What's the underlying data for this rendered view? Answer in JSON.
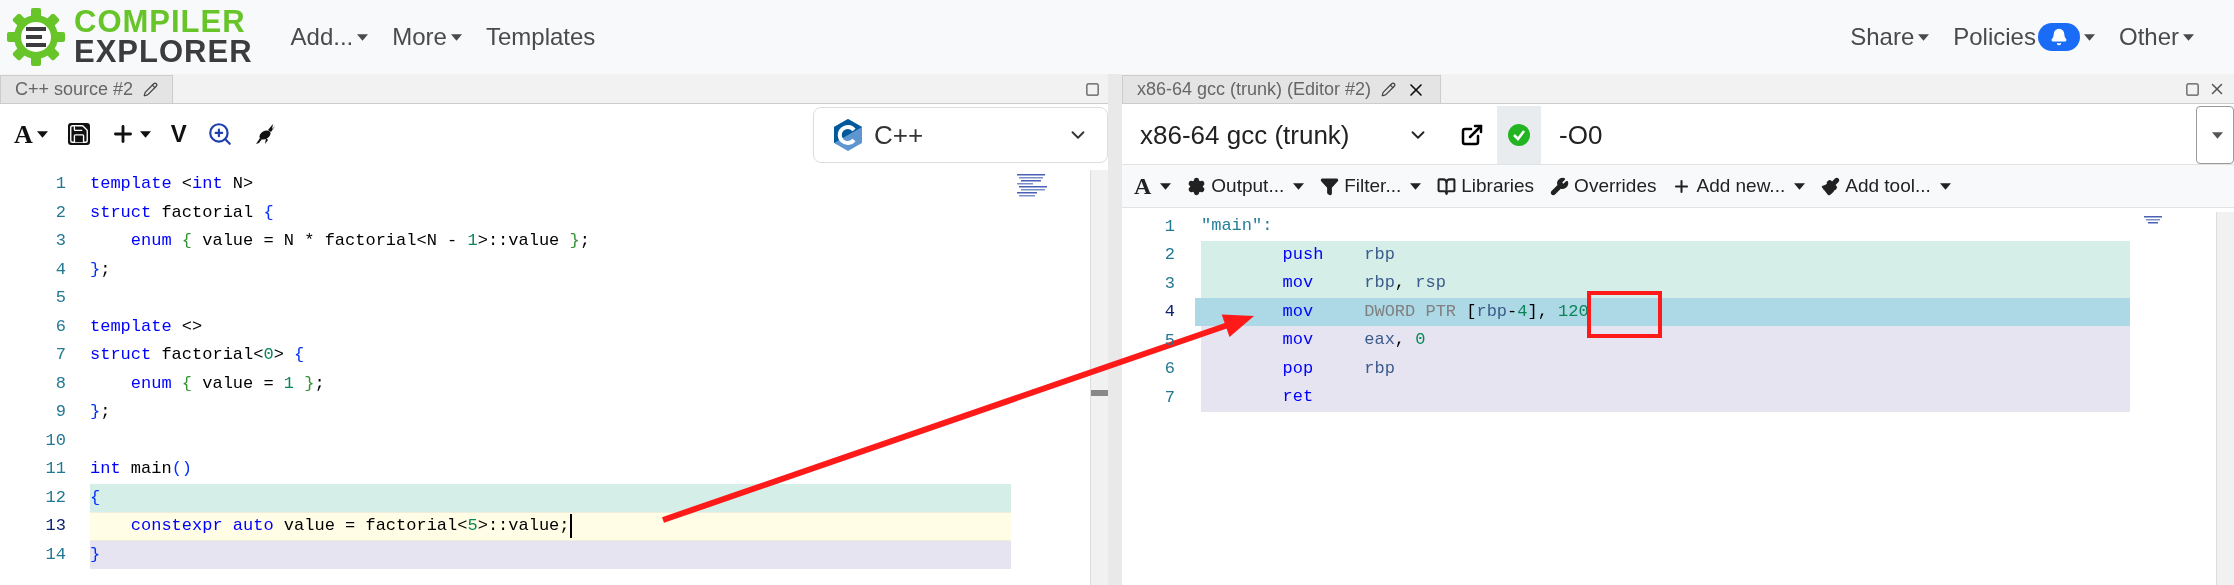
{
  "navbar": {
    "logo": {
      "line1": "COMPILER",
      "line2": "EXPLORER"
    },
    "menus": [
      {
        "label": "Add...",
        "dropdown": true
      },
      {
        "label": "More",
        "dropdown": true
      },
      {
        "label": "Templates",
        "dropdown": false
      }
    ],
    "right_menus": [
      {
        "label": "Share",
        "dropdown": true,
        "notification": false
      },
      {
        "label": "Policies",
        "dropdown": true,
        "notification": true
      },
      {
        "label": "Other",
        "dropdown": true,
        "notification": false
      }
    ]
  },
  "source_pane": {
    "tab": {
      "title": "C++ source #2"
    },
    "toolbar": [
      {
        "kind": "font",
        "label": "A",
        "dropdown": true
      },
      {
        "kind": "save",
        "dropdown": false
      },
      {
        "kind": "add",
        "dropdown": true
      },
      {
        "kind": "vim",
        "label": "V",
        "dropdown": false
      },
      {
        "kind": "insights",
        "dropdown": false
      },
      {
        "kind": "bench",
        "dropdown": false
      }
    ],
    "language": "C++",
    "lines": [
      {
        "number": "1",
        "current": false,
        "tokens": [
          {
            "text": "template",
            "kind": "keyword"
          },
          {
            "text": " <",
            "kind": "plain"
          },
          {
            "text": "int",
            "kind": "keyword"
          },
          {
            "text": " N>",
            "kind": "plain"
          }
        ]
      },
      {
        "number": "2",
        "current": false,
        "tokens": [
          {
            "text": "struct",
            "kind": "keyword"
          },
          {
            "text": " factorial ",
            "kind": "plain"
          },
          {
            "text": "{",
            "kind": "bracket_1"
          }
        ]
      },
      {
        "number": "3",
        "current": false,
        "tokens": [
          {
            "text": "    enum",
            "kind": "keyword"
          },
          {
            "text": " {",
            "kind": "bracket_2"
          },
          {
            "text": " value = N * factorial<N - ",
            "kind": "plain"
          },
          {
            "text": "1",
            "kind": "number"
          },
          {
            "text": ">::value ",
            "kind": "plain"
          },
          {
            "text": "}",
            "kind": "bracket_2"
          },
          {
            "text": ";",
            "kind": "plain"
          }
        ]
      },
      {
        "number": "4",
        "current": false,
        "tokens": [
          {
            "text": "}",
            "kind": "bracket_1"
          },
          {
            "text": ";",
            "kind": "plain"
          }
        ]
      },
      {
        "number": "5",
        "current": false
      },
      {
        "number": "6",
        "current": false,
        "tokens": [
          {
            "text": "template",
            "kind": "keyword"
          },
          {
            "text": " <>",
            "kind": "plain"
          }
        ]
      },
      {
        "number": "7",
        "current": false,
        "tokens": [
          {
            "text": "struct",
            "kind": "keyword"
          },
          {
            "text": " factorial<",
            "kind": "plain"
          },
          {
            "text": "0",
            "kind": "number"
          },
          {
            "text": "> ",
            "kind": "plain"
          },
          {
            "text": "{",
            "kind": "bracket_1"
          }
        ]
      },
      {
        "number": "8",
        "current": false,
        "tokens": [
          {
            "text": "    enum",
            "kind": "keyword"
          },
          {
            "text": " {",
            "kind": "bracket_2"
          },
          {
            "text": " value = ",
            "kind": "plain"
          },
          {
            "text": "1",
            "kind": "number"
          },
          {
            "text": " }",
            "kind": "bracket_2"
          },
          {
            "text": ";",
            "kind": "plain"
          }
        ]
      },
      {
        "number": "9",
        "current": false,
        "tokens": [
          {
            "text": "}",
            "kind": "bracket_1"
          },
          {
            "text": ";",
            "kind": "plain"
          }
        ]
      },
      {
        "number": "10",
        "current": false
      },
      {
        "number": "11",
        "current": false,
        "tokens": [
          {
            "text": "int",
            "kind": "keyword"
          },
          {
            "text": " main",
            "kind": "plain"
          },
          {
            "text": "()",
            "kind": "bracket_1"
          }
        ]
      },
      {
        "number": "12",
        "color": "#d5eee7",
        "current": false,
        "tokens": [
          {
            "text": "{",
            "kind": "bracket_1"
          }
        ]
      },
      {
        "number": "13",
        "current": true,
        "tokens": [
          {
            "text": "    constexpr",
            "kind": "keyword"
          },
          {
            "text": " auto",
            "kind": "keyword"
          },
          {
            "text": " value = factorial<",
            "kind": "plain"
          },
          {
            "text": "5",
            "kind": "number"
          },
          {
            "text": ">::value;",
            "kind": "plain"
          }
        ]
      },
      {
        "number": "14",
        "color": "#e6e4f0",
        "current": false,
        "tokens": [
          {
            "text": "}",
            "kind": "bracket_1"
          }
        ]
      }
    ]
  },
  "compiler_pane": {
    "tab": {
      "title": "x86-64 gcc (trunk) (Editor #2)"
    },
    "compiler": "x86-64 gcc (trunk)",
    "status_ok": true,
    "options": "-O0",
    "toolbar": [
      {
        "kind": "font",
        "label": "A",
        "dropdown": true
      },
      {
        "kind": "output",
        "label": "Output...",
        "dropdown": true
      },
      {
        "kind": "filter",
        "label": "Filter...",
        "dropdown": true
      },
      {
        "kind": "libraries",
        "label": "Libraries",
        "dropdown": false
      },
      {
        "kind": "overrides",
        "label": "Overrides",
        "dropdown": false
      },
      {
        "kind": "add",
        "label": "Add new...",
        "dropdown": true
      },
      {
        "kind": "tool",
        "label": "Add tool...",
        "dropdown": true
      }
    ],
    "lines": [
      {
        "number": "1",
        "selected": false,
        "tokens": [
          {
            "text": "\"main\":",
            "kind": "label"
          }
        ]
      },
      {
        "number": "2",
        "color": "#d5eee7",
        "selected": false,
        "tokens": [
          {
            "text": "        push",
            "kind": "opcode"
          },
          {
            "text": "    rbp",
            "kind": "register"
          }
        ]
      },
      {
        "number": "3",
        "color": "#d5eee7",
        "selected": false,
        "tokens": [
          {
            "text": "        mov",
            "kind": "opcode"
          },
          {
            "text": "     rbp",
            "kind": "register"
          },
          {
            "text": ", ",
            "kind": "plain"
          },
          {
            "text": "rsp",
            "kind": "register"
          }
        ]
      },
      {
        "number": "4",
        "color": "#add8e6",
        "selected": true,
        "tokens": [
          {
            "text": "        mov",
            "kind": "opcode"
          },
          {
            "text": "     DWORD PTR",
            "kind": "size"
          },
          {
            "text": " [",
            "kind": "plain"
          },
          {
            "text": "rbp",
            "kind": "register"
          },
          {
            "text": "-",
            "kind": "plain"
          },
          {
            "text": "4",
            "kind": "number"
          },
          {
            "text": "], ",
            "kind": "plain"
          },
          {
            "text": "120",
            "kind": "number"
          }
        ]
      },
      {
        "number": "5",
        "color": "#e6e4f0",
        "selected": false,
        "tokens": [
          {
            "text": "        mov",
            "kind": "opcode"
          },
          {
            "text": "     eax",
            "kind": "register"
          },
          {
            "text": ", ",
            "kind": "plain"
          },
          {
            "text": "0",
            "kind": "number"
          }
        ]
      },
      {
        "number": "6",
        "color": "#e6e4f0",
        "selected": false,
        "tokens": [
          {
            "text": "        pop",
            "kind": "opcode"
          },
          {
            "text": "     rbp",
            "kind": "register"
          }
        ]
      },
      {
        "number": "7",
        "color": "#e6e4f0",
        "selected": false,
        "tokens": [
          {
            "text": "        ret",
            "kind": "opcode"
          }
        ]
      }
    ]
  }
}
